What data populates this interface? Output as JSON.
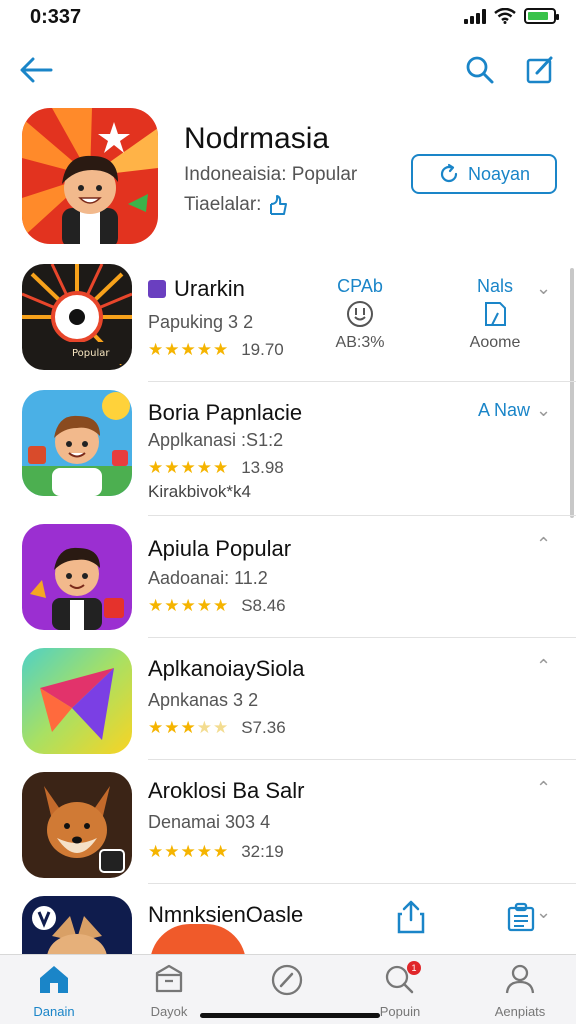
{
  "status": {
    "time": "0:337"
  },
  "hero": {
    "title": "Nodrmasia",
    "subtitle": "Indoneaisia: Popular",
    "meta": "Tiaelalar:",
    "button_label": "Noayan"
  },
  "apps": [
    {
      "title": "Urarkin",
      "sub": "Papuking 3 2",
      "rating": 5,
      "score": "19.70",
      "col1": {
        "label": "CPAb",
        "value": "AB:3%"
      },
      "col2": {
        "label": "Nals",
        "value": "Aoome"
      }
    },
    {
      "title": "Boria Papnlacie",
      "sub": "Applkanasi :S1:2",
      "rating": 5,
      "score": "13.98",
      "extra": "Kirakbivok*k4",
      "action": "A Naw"
    },
    {
      "title": "Apiula Popular",
      "sub": "Aadoanai: 11.2",
      "rating": 5,
      "score": "S8.46"
    },
    {
      "title": "AplkanoiaySiola",
      "sub": "Apnkanas 3 2",
      "rating": 3,
      "score": "S7.36"
    },
    {
      "title": "Aroklosi Ba Salr",
      "sub": "Denamai 303 4",
      "rating": 5,
      "score": "32:19"
    },
    {
      "title": "NmnksienOasle"
    }
  ],
  "tabs": [
    {
      "label": "Danain",
      "icon": "home-icon"
    },
    {
      "label": "Dayok",
      "icon": "box-icon"
    },
    {
      "label": "",
      "icon": "compass-icon"
    },
    {
      "label": "Popuin",
      "icon": "search-badge-icon",
      "badge": "1"
    },
    {
      "label": "Aenpiats",
      "icon": "person-icon"
    }
  ],
  "colors": {
    "accent": "#1a85c8",
    "star": "#f5b400",
    "badge": "#e0262a"
  }
}
